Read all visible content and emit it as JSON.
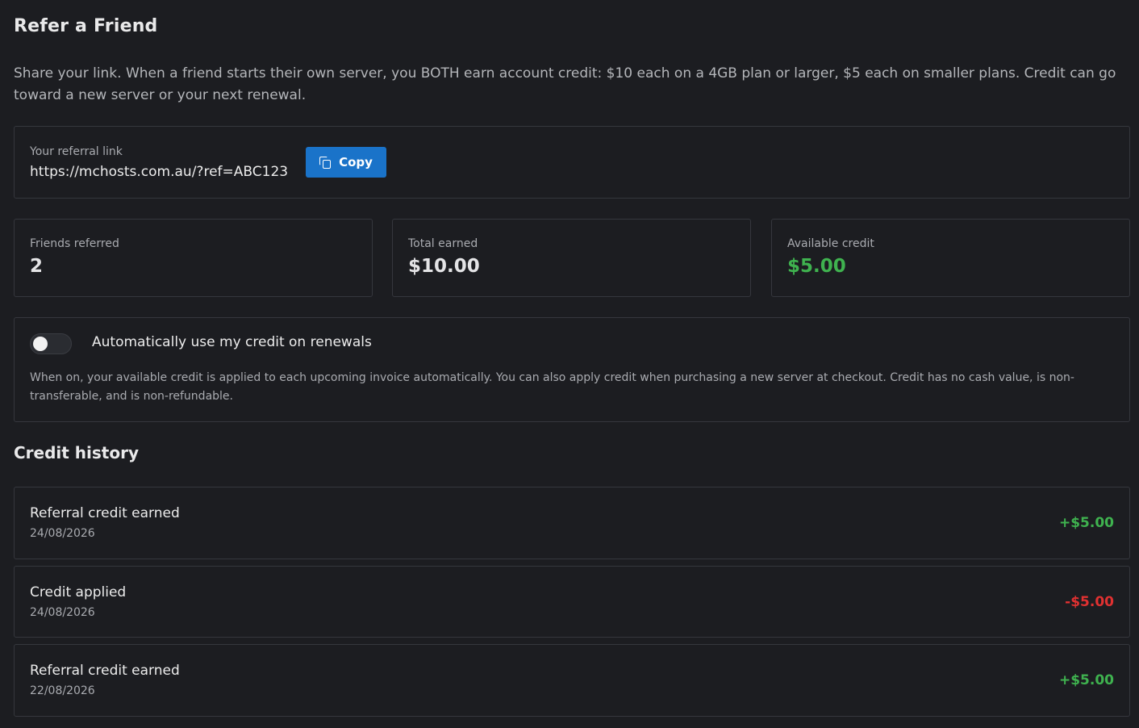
{
  "page": {
    "title": "Refer a Friend",
    "intro": "Share your link. When a friend starts their own server, you BOTH earn account credit: $10 each on a 4GB plan or larger, $5 each on smaller plans. Credit can go toward a new server or your next renewal."
  },
  "referral": {
    "label": "Your referral link",
    "link": "https://mchosts.com.au/?ref=ABC123",
    "copy_label": "Copy",
    "copy_icon": "copy-icon"
  },
  "stats": [
    {
      "label": "Friends referred",
      "value": "2"
    },
    {
      "label": "Total earned",
      "value": "$10.00"
    },
    {
      "label": "Available credit",
      "value": "$5.00",
      "color": "#3fb24f"
    }
  ],
  "auto_credit": {
    "label": "Automatically use my credit on renewals",
    "enabled": false,
    "description": "When on, your available credit is applied to each upcoming invoice automatically. You can also apply credit when purchasing a new server at checkout. Credit has no cash value, is non-transferable, and is non-refundable."
  },
  "history": {
    "title": "Credit history",
    "items": [
      {
        "title": "Referral credit earned",
        "date": "24/08/2026",
        "amount": "+$5.00",
        "color": "#3fb24f"
      },
      {
        "title": "Credit applied",
        "date": "24/08/2026",
        "amount": "-$5.00",
        "color": "#e03131"
      },
      {
        "title": "Referral credit earned",
        "date": "22/08/2026",
        "amount": "+$5.00",
        "color": "#3fb24f"
      }
    ]
  },
  "colors": {
    "background": "#1c1d21",
    "border": "#35373d",
    "accent": "#1a73c9",
    "positive": "#3fb24f",
    "negative": "#e03131"
  }
}
